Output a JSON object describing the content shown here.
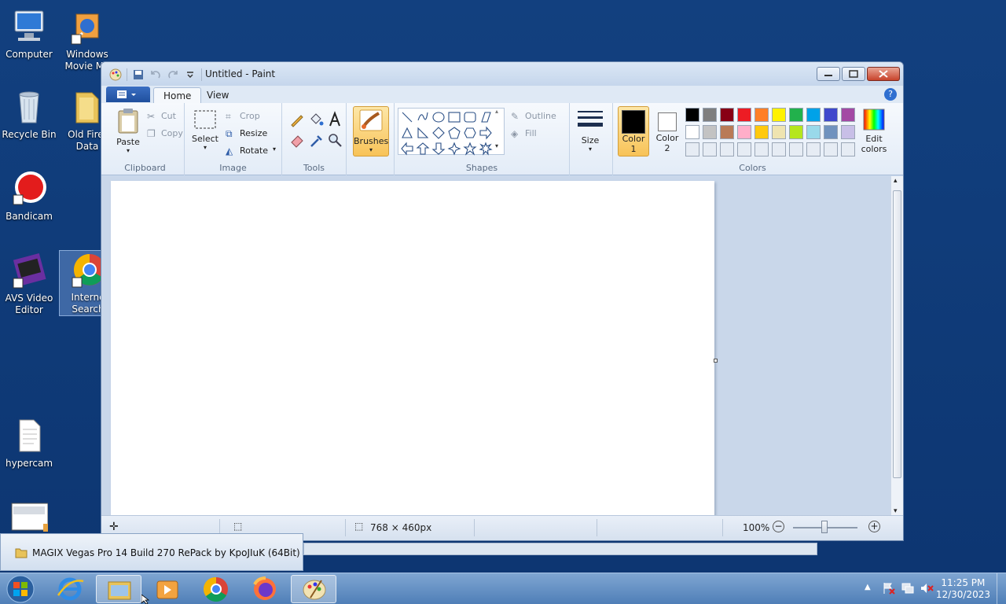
{
  "desktop": {
    "icons": [
      {
        "label": "Computer"
      },
      {
        "label": "Windows Movie Ma"
      },
      {
        "label": "Recycle Bin"
      },
      {
        "label": "Old Firef Data"
      },
      {
        "label": "Bandicam"
      },
      {
        "label": "AVS Video Editor"
      },
      {
        "label": "Interne Search"
      },
      {
        "label": "hypercam"
      }
    ]
  },
  "window": {
    "title": "Untitled - Paint",
    "tabs": {
      "home": "Home",
      "view": "View"
    },
    "ribbon": {
      "clipboard": {
        "label": "Clipboard",
        "paste": "Paste",
        "cut": "Cut",
        "copy": "Copy"
      },
      "image": {
        "label": "Image",
        "select": "Select",
        "crop": "Crop",
        "resize": "Resize",
        "rotate": "Rotate"
      },
      "tools": {
        "label": "Tools"
      },
      "brushes": "Brushes",
      "shapes": {
        "label": "Shapes",
        "outline": "Outline",
        "fill": "Fill"
      },
      "size": "Size",
      "color1": {
        "line1": "Color",
        "line2": "1",
        "value": "#000000"
      },
      "color2": {
        "line1": "Color",
        "line2": "2",
        "value": "#ffffff"
      },
      "colors": {
        "label": "Colors",
        "edit": "Edit colors",
        "palette_row1": [
          "#000000",
          "#7f7f7f",
          "#880015",
          "#ed1c24",
          "#ff7f27",
          "#fff200",
          "#22b14c",
          "#00a2e8",
          "#3f48cc",
          "#a349a4"
        ],
        "palette_row2": [
          "#ffffff",
          "#c3c3c3",
          "#b97a57",
          "#ffaec9",
          "#ffc90e",
          "#efe4b0",
          "#b5e61d",
          "#99d9ea",
          "#7092be",
          "#c8bfe7"
        ]
      }
    },
    "status": {
      "size": "768 × 460px",
      "zoom": "100%"
    }
  },
  "taskbar": {
    "popup_title": "MAGIX Vegas Pro 14 Build 270 RePack by KpoJIuK (64Bit)",
    "time": "11:25 PM",
    "date": "12/30/2023"
  }
}
